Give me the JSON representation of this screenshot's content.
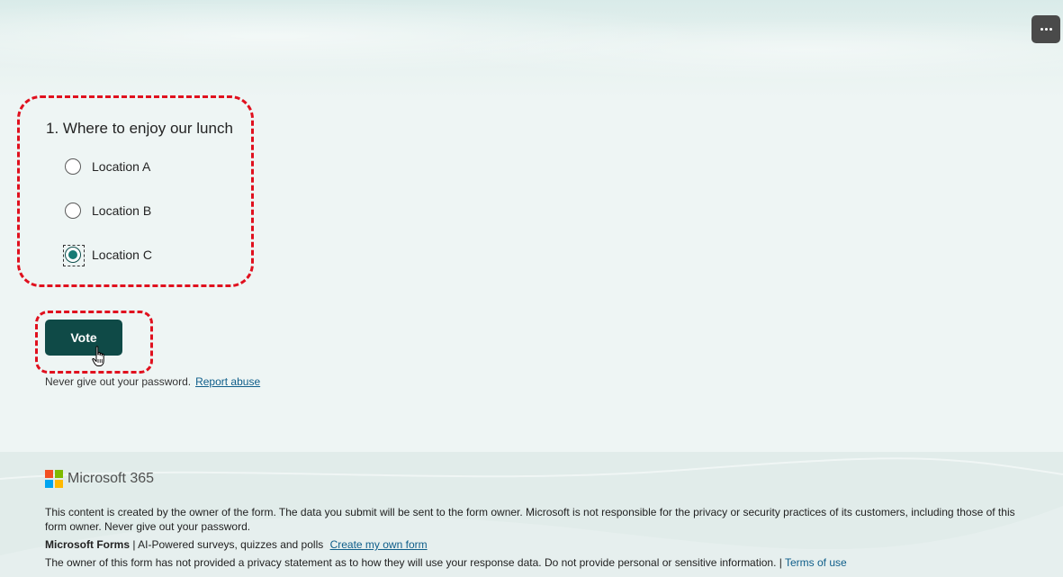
{
  "header": {
    "more_icon": "more-horizontal-icon"
  },
  "question": {
    "title": "1. Where to enjoy our lunch",
    "options": [
      {
        "label": "Location A",
        "selected": false
      },
      {
        "label": "Location B",
        "selected": false
      },
      {
        "label": "Location C",
        "selected": true
      }
    ]
  },
  "actions": {
    "vote_label": "Vote"
  },
  "notice": {
    "password_text": "Never give out your password.",
    "report_link": "Report abuse"
  },
  "footer": {
    "brand": "Microsoft 365",
    "disclaimer": "This content is created by the owner of the form. The data you submit will be sent to the form owner. Microsoft is not responsible for the privacy or security practices of its customers, including those of this form owner. Never give out your password.",
    "forms_name": "Microsoft Forms",
    "forms_tagline": " | AI-Powered surveys, quizzes and polls ",
    "create_link": "Create my own form",
    "privacy_text": "The owner of this form has not provided a privacy statement as to how they will use your response data. Do not provide personal or sensitive information. | ",
    "terms_link": "Terms of use"
  },
  "colors": {
    "accent": "#0f4a47",
    "highlight": "#e0101e",
    "link": "#0f5e8a"
  }
}
